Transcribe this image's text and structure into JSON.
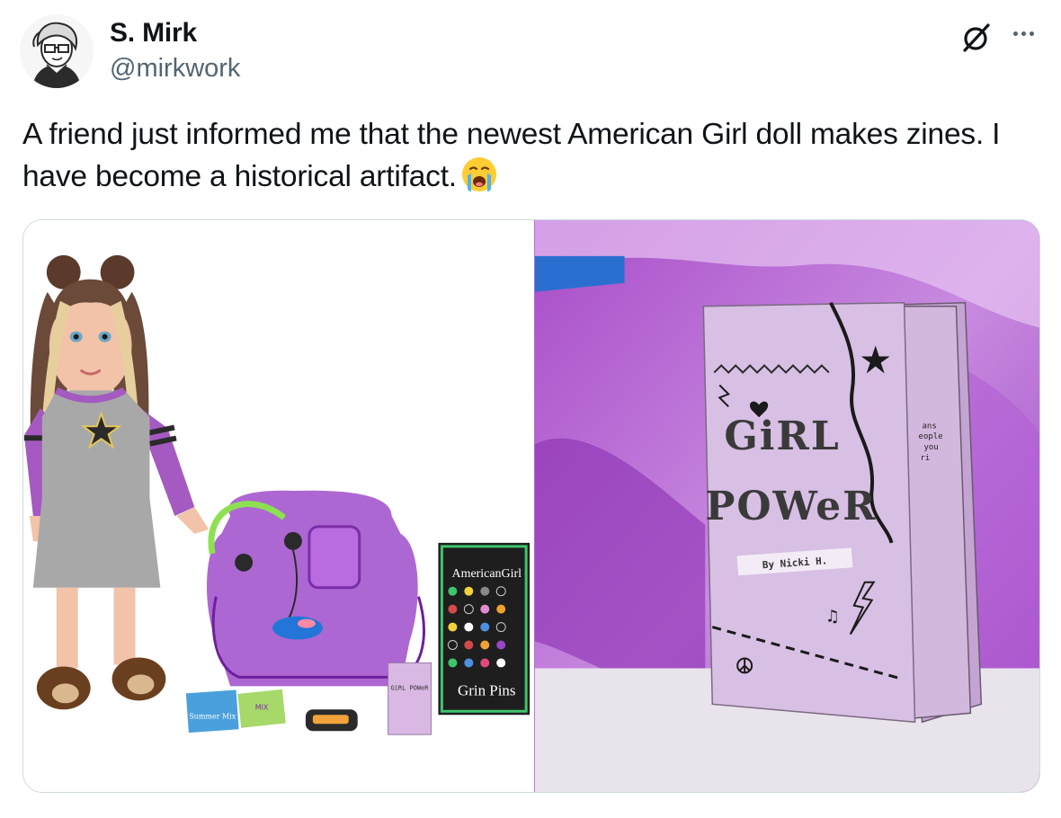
{
  "author": {
    "name": "S. Mirk",
    "handle": "@mirkwork"
  },
  "tweet": {
    "text": "A friend just informed me that the newest American Girl doll makes zines. I have become a historical artifact.",
    "emoji": "loudly-crying-face"
  },
  "icons": {
    "grok": "grok-icon",
    "more": "more-options-icon"
  },
  "media": {
    "left_photo": {
      "box_brand": "AmericanGirl",
      "box_title": "Grin Pins",
      "cd_label": "Summer Mix",
      "cd2_label": "MIX",
      "mini_zine_label": "GiRL POWeR"
    },
    "right_photo": {
      "zine_title_line1": "GiRL",
      "zine_title_line2": "POWeR",
      "zine_byline": "By Nicki H.",
      "inner_page_text_1": "ans",
      "inner_page_text_2": "eople",
      "inner_page_text_3": "you",
      "inner_page_text_4": "ri"
    }
  },
  "colors": {
    "text": "#0f1419",
    "secondary": "#536471",
    "border": "#cfd9de",
    "purple": "#b86bd0"
  }
}
